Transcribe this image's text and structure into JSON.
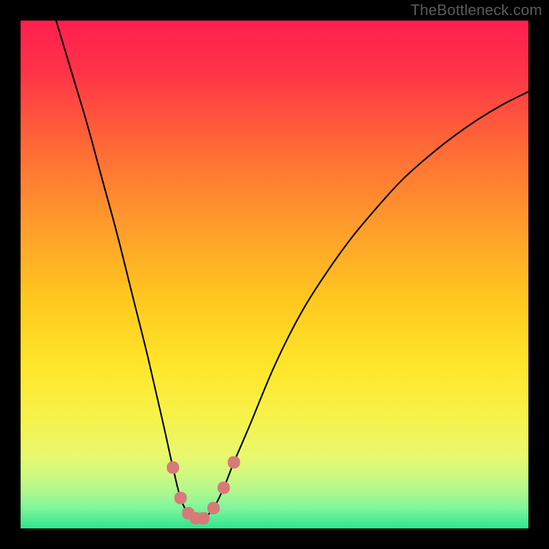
{
  "watermark": "TheBottleneck.com",
  "colors": {
    "frame": "#000000",
    "gradient_stops": [
      {
        "offset": 0.0,
        "color": "#ff1f4f"
      },
      {
        "offset": 0.1,
        "color": "#ff3348"
      },
      {
        "offset": 0.25,
        "color": "#ff6a36"
      },
      {
        "offset": 0.4,
        "color": "#ff9b2c"
      },
      {
        "offset": 0.55,
        "color": "#ffc81f"
      },
      {
        "offset": 0.68,
        "color": "#ffe62a"
      },
      {
        "offset": 0.78,
        "color": "#f7f24a"
      },
      {
        "offset": 0.86,
        "color": "#e8f86f"
      },
      {
        "offset": 0.92,
        "color": "#b9f88a"
      },
      {
        "offset": 0.96,
        "color": "#7ef59b"
      },
      {
        "offset": 1.0,
        "color": "#2ee58f"
      }
    ],
    "curve": "#000000",
    "markers_fill": "#d77a78",
    "markers_stroke": "#b85d5b"
  },
  "chart_data": {
    "type": "line",
    "title": "",
    "xlabel": "",
    "ylabel": "",
    "xlim": [
      0,
      100
    ],
    "ylim": [
      0,
      100
    ],
    "series": [
      {
        "name": "bottleneck-curve",
        "x": [
          7,
          10,
          13,
          16,
          19,
          22,
          25,
          28,
          30,
          31.5,
          33,
          34.5,
          36,
          38,
          40,
          42,
          45,
          50,
          55,
          60,
          65,
          70,
          75,
          80,
          85,
          90,
          95,
          100
        ],
        "y": [
          100,
          90,
          80,
          69,
          58,
          46,
          34,
          21,
          12,
          6,
          3,
          2,
          2,
          4,
          8,
          13,
          20,
          32,
          42,
          50,
          57,
          63,
          68.5,
          73,
          77,
          80.5,
          83.5,
          86
        ]
      }
    ],
    "markers": {
      "name": "highlight-dots",
      "x": [
        30,
        31.5,
        33,
        34.5,
        36,
        38,
        40,
        42
      ],
      "y": [
        12,
        6,
        3,
        2,
        2,
        4,
        8,
        13
      ]
    },
    "notes": "Axes are unitless (no ticks or labels rendered in source). x spans 0–100 left→right, y spans 0 (bottom) → 100 (top). Curve values estimated from pixel positions."
  }
}
